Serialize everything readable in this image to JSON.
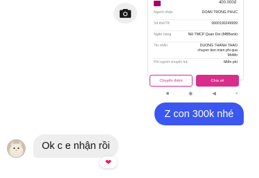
{
  "camera": {
    "icon": "camera-icon"
  },
  "receipt": {
    "amount": "400.000đ",
    "rows": [
      {
        "label": "Người nhận",
        "value": "DOAN TRONG PHUC"
      },
      {
        "label": "Số thẻ/TK",
        "value": "0000190249999"
      },
      {
        "label": "Ngân hàng",
        "value": "NH TMCP Quan Doi (MBBank)"
      },
      {
        "label": "Tin nhắn",
        "value": "DUONG THANH THAO chuyen tien mien phi qua MoMo"
      },
      {
        "label": "Phí người chuyển trả",
        "value": "Miễn phí"
      }
    ],
    "btn_more": "Chuyển thêm",
    "btn_share": "Chia sẻ",
    "nav": [
      "■",
      "◉",
      "◀",
      "+"
    ]
  },
  "chat": {
    "sent_message": "Z con 300k nhé",
    "received_message": "Ok c e nhận rồi",
    "reaction": "❤"
  },
  "colors": {
    "sent_bubble": "#3b57ef",
    "received_bubble": "#eeeeee",
    "momo_pink": "#d82d8b"
  }
}
